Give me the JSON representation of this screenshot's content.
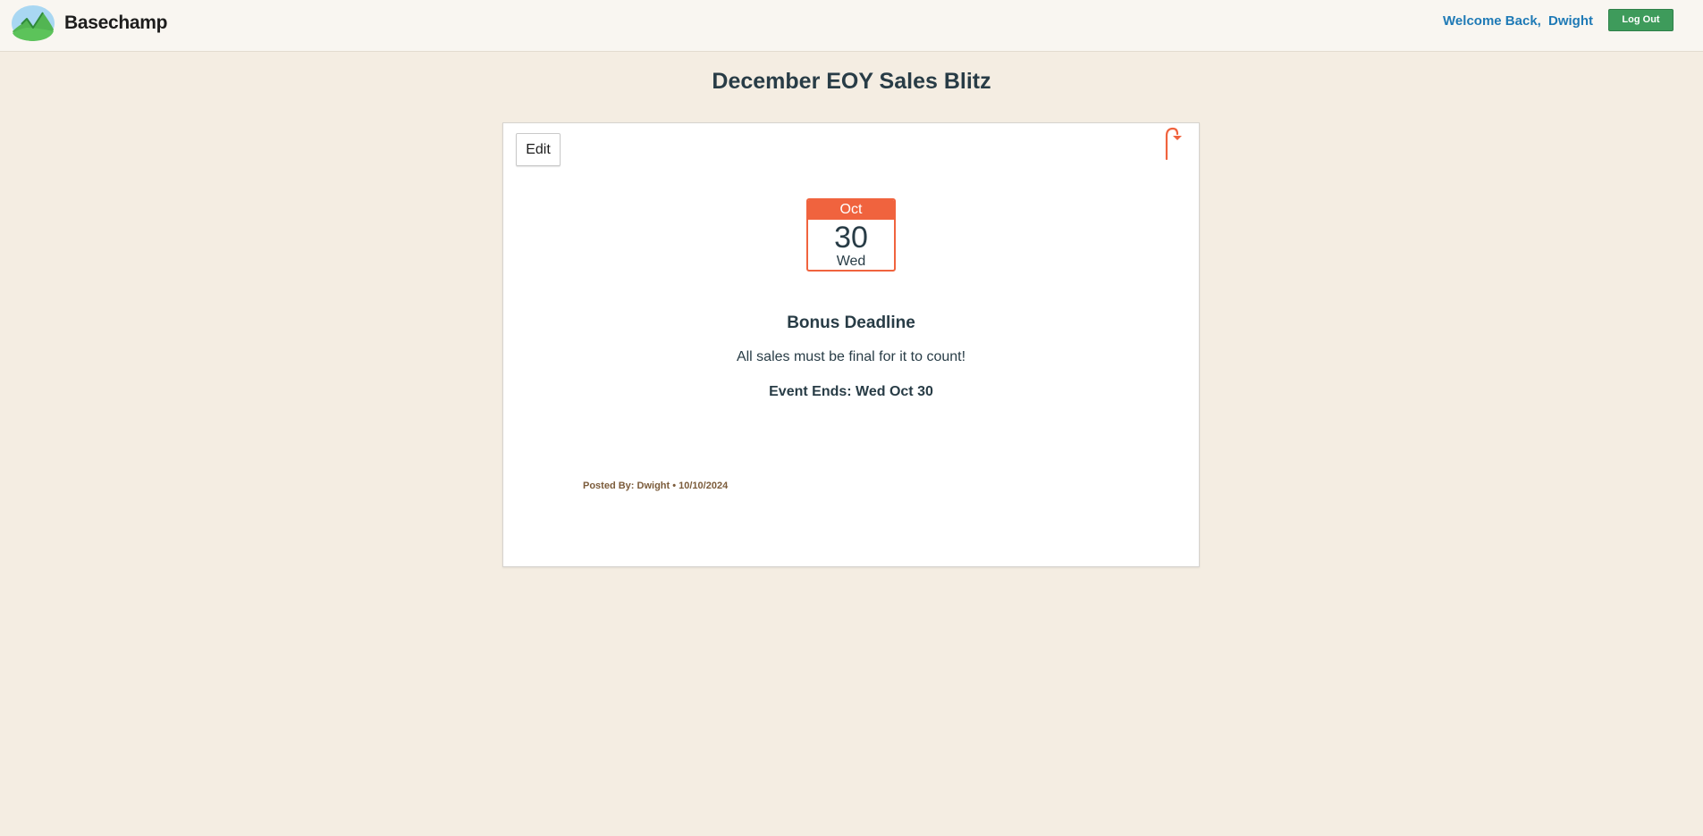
{
  "header": {
    "brand_name": "Basechamp",
    "logo_icon": "basecamp-mountain-logo",
    "welcome_text": "Welcome Back,",
    "user_name": "Dwight",
    "logout_label": "Log Out"
  },
  "page": {
    "title": "December EOY Sales Blitz"
  },
  "event": {
    "edit_label": "Edit",
    "bookmark_icon": "bookmark-ribbon-icon",
    "date": {
      "month": "Oct",
      "day": "30",
      "weekday": "Wed"
    },
    "title": "Bonus Deadline",
    "description": "All sales must be final for it to count!",
    "ends": "Event Ends: Wed Oct 30",
    "posted_by": "Posted By: Dwight • 10/10/2024"
  },
  "colors": {
    "background": "#f4ede2",
    "header_background": "#f9f6f1",
    "link_blue": "#1f7ab6",
    "logout_green": "#3e9b5b",
    "accent_orange": "#f0633e",
    "text_dark": "#283c46",
    "posted_brown": "#7b5b3a"
  }
}
